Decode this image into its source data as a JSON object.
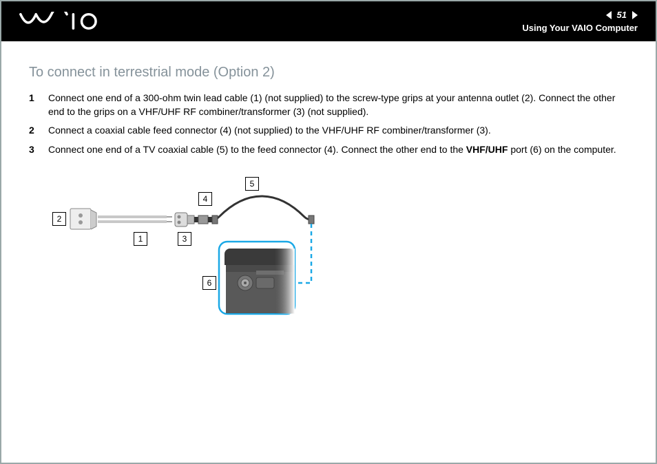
{
  "header": {
    "logo_alt": "VAIO",
    "page_number": "51",
    "section": "Using Your VAIO Computer"
  },
  "heading": "To connect in terrestrial mode (Option 2)",
  "steps": [
    {
      "n": "1",
      "html": "Connect one end of a 300-ohm twin lead cable (1) (not supplied) to the screw-type grips at your antenna outlet (2). Connect the other end to the grips on a VHF/UHF RF combiner/transformer (3) (not supplied)."
    },
    {
      "n": "2",
      "html": "Connect a coaxial cable feed connector (4) (not supplied) to the VHF/UHF RF combiner/transformer (3)."
    },
    {
      "n": "3",
      "html": "Connect one end of a TV coaxial cable (5) to the feed connector (4). Connect the other end to the <b>VHF/UHF</b> port (6) on the computer."
    }
  ],
  "callouts": {
    "c1": "1",
    "c2": "2",
    "c3": "3",
    "c4": "4",
    "c5": "5",
    "c6": "6"
  }
}
